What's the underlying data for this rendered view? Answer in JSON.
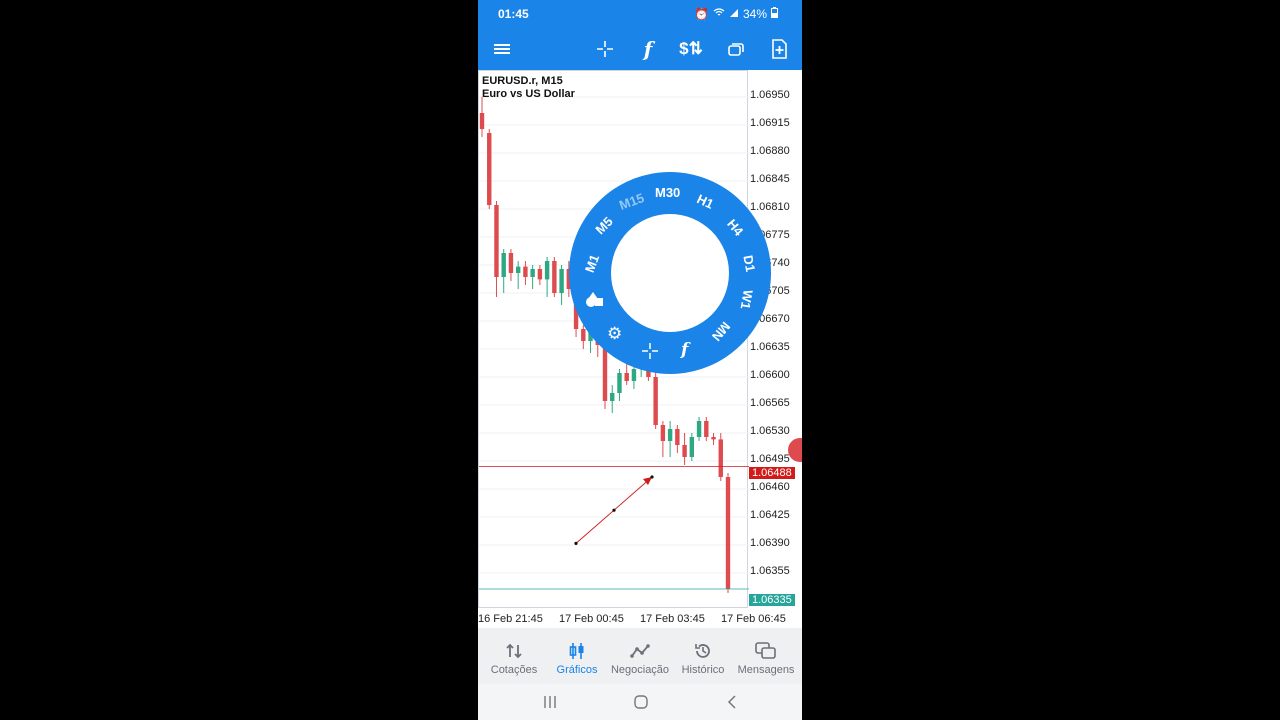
{
  "status_bar": {
    "time": "01:45",
    "battery": "34%"
  },
  "toolbar": {
    "icons": [
      "menu-icon",
      "crosshair-icon",
      "function-icon",
      "dollar-arrows-icon",
      "windows-icon",
      "new-order-icon"
    ]
  },
  "chart": {
    "symbol_line": "EURUSD.r, M15",
    "description": "Euro vs US Dollar",
    "current_bid": "1.06488",
    "current_ask": "1.06335",
    "colors": {
      "bull": "#2ea882",
      "bear": "#de4b4f",
      "bid_line": "#d11a1a",
      "ask_line": "#26a69a",
      "accent": "#1a84e8"
    }
  },
  "chart_data": {
    "type": "candlestick",
    "title": "EURUSD.r, M15",
    "subtitle": "Euro vs US Dollar",
    "y_ticks": [
      "1.06950",
      "1.06915",
      "1.06880",
      "1.06845",
      "1.06810",
      "1.06775",
      "1.06740",
      "1.06705",
      "1.06670",
      "1.06635",
      "1.06600",
      "1.06565",
      "1.06530",
      "1.06495",
      "1.06460",
      "1.06425",
      "1.06390",
      "1.06355"
    ],
    "x_ticks": [
      "16 Feb 21:45",
      "17 Feb 00:45",
      "17 Feb 03:45",
      "17 Feb 06:45"
    ],
    "ylim": [
      1.0632,
      1.0697
    ],
    "candles": [
      {
        "o": 1.0693,
        "h": 1.0695,
        "l": 1.069,
        "c": 1.0691
      },
      {
        "o": 1.06905,
        "h": 1.0691,
        "l": 1.0681,
        "c": 1.06815
      },
      {
        "o": 1.06815,
        "h": 1.0682,
        "l": 1.067,
        "c": 1.06725
      },
      {
        "o": 1.06725,
        "h": 1.0676,
        "l": 1.06705,
        "c": 1.06755
      },
      {
        "o": 1.06755,
        "h": 1.0676,
        "l": 1.0672,
        "c": 1.0673
      },
      {
        "o": 1.0673,
        "h": 1.06745,
        "l": 1.0671,
        "c": 1.06738
      },
      {
        "o": 1.06738,
        "h": 1.06745,
        "l": 1.06715,
        "c": 1.06725
      },
      {
        "o": 1.06725,
        "h": 1.0674,
        "l": 1.0671,
        "c": 1.06735
      },
      {
        "o": 1.06735,
        "h": 1.0674,
        "l": 1.06715,
        "c": 1.06722
      },
      {
        "o": 1.06722,
        "h": 1.0675,
        "l": 1.067,
        "c": 1.06745
      },
      {
        "o": 1.06745,
        "h": 1.0675,
        "l": 1.067,
        "c": 1.06705
      },
      {
        "o": 1.06705,
        "h": 1.0674,
        "l": 1.0669,
        "c": 1.06735
      },
      {
        "o": 1.06735,
        "h": 1.06745,
        "l": 1.067,
        "c": 1.0671
      },
      {
        "o": 1.0671,
        "h": 1.0672,
        "l": 1.0665,
        "c": 1.0666
      },
      {
        "o": 1.0666,
        "h": 1.06665,
        "l": 1.06635,
        "c": 1.06645
      },
      {
        "o": 1.06645,
        "h": 1.06665,
        "l": 1.0663,
        "c": 1.0666
      },
      {
        "o": 1.0666,
        "h": 1.06665,
        "l": 1.06625,
        "c": 1.0664
      },
      {
        "o": 1.0664,
        "h": 1.0665,
        "l": 1.0656,
        "c": 1.0657
      },
      {
        "o": 1.0657,
        "h": 1.0659,
        "l": 1.06555,
        "c": 1.0658
      },
      {
        "o": 1.0658,
        "h": 1.0661,
        "l": 1.0657,
        "c": 1.06605
      },
      {
        "o": 1.06605,
        "h": 1.06625,
        "l": 1.0659,
        "c": 1.06595
      },
      {
        "o": 1.06595,
        "h": 1.06615,
        "l": 1.06585,
        "c": 1.0661
      },
      {
        "o": 1.0661,
        "h": 1.0663,
        "l": 1.066,
        "c": 1.06625
      },
      {
        "o": 1.06625,
        "h": 1.0663,
        "l": 1.06595,
        "c": 1.066
      },
      {
        "o": 1.066,
        "h": 1.06605,
        "l": 1.06535,
        "c": 1.0654
      },
      {
        "o": 1.0654,
        "h": 1.06545,
        "l": 1.065,
        "c": 1.0652
      },
      {
        "o": 1.0652,
        "h": 1.06545,
        "l": 1.065,
        "c": 1.06535
      },
      {
        "o": 1.06535,
        "h": 1.0654,
        "l": 1.06505,
        "c": 1.06515
      },
      {
        "o": 1.06515,
        "h": 1.0653,
        "l": 1.0649,
        "c": 1.065
      },
      {
        "o": 1.065,
        "h": 1.0653,
        "l": 1.06495,
        "c": 1.06525
      },
      {
        "o": 1.06525,
        "h": 1.0655,
        "l": 1.0652,
        "c": 1.06545
      },
      {
        "o": 1.06545,
        "h": 1.0655,
        "l": 1.0652,
        "c": 1.06525
      },
      {
        "o": 1.06525,
        "h": 1.0653,
        "l": 1.06515,
        "c": 1.06522
      },
      {
        "o": 1.06522,
        "h": 1.0653,
        "l": 1.0647,
        "c": 1.06475
      },
      {
        "o": 1.06475,
        "h": 1.0648,
        "l": 1.0633,
        "c": 1.06335
      }
    ]
  },
  "timeframe_wheel": {
    "timeframes": [
      "M1",
      "M5",
      "M15",
      "M30",
      "H1",
      "H4",
      "D1",
      "W1",
      "MN"
    ],
    "selected": "M15",
    "tool_icons": [
      "shapes-icon",
      "settings-icon",
      "crosshair-icon",
      "function-icon"
    ]
  },
  "bottom_nav": [
    {
      "label": "Cotações",
      "icon": "quotes-icon",
      "active": false
    },
    {
      "label": "Gráficos",
      "icon": "charts-icon",
      "active": true
    },
    {
      "label": "Negociação",
      "icon": "trade-icon",
      "active": false
    },
    {
      "label": "Histórico",
      "icon": "history-icon",
      "active": false
    },
    {
      "label": "Mensagens",
      "icon": "messages-icon",
      "active": false
    }
  ]
}
